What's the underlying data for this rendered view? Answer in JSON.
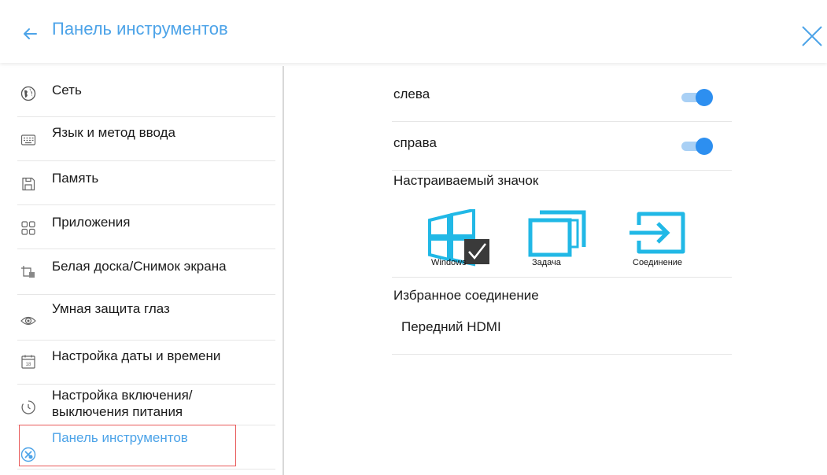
{
  "header": {
    "title": "Панель инструментов"
  },
  "sidebar": {
    "items": [
      {
        "label": "Сеть",
        "icon": "globe-icon"
      },
      {
        "label": "Язык и метод ввода",
        "icon": "keyboard-icon"
      },
      {
        "label": "Память",
        "icon": "storage-icon"
      },
      {
        "label": "Приложения",
        "icon": "apps-grid-icon"
      },
      {
        "label": "Белая доска/Снимок экрана",
        "icon": "whiteboard-icon"
      },
      {
        "label": "Умная защита глаз",
        "icon": "eye-icon"
      },
      {
        "label": "Настройка даты и времени",
        "icon": "calendar-icon",
        "icon_text": "18"
      },
      {
        "label": "Настройка включения/ выключения питания",
        "icon": "timer-icon"
      },
      {
        "label": "Панель инструментов",
        "icon": "toolbar-icon",
        "active": true
      }
    ]
  },
  "content": {
    "left_label": "слева",
    "right_label": "справа",
    "custom_icon_heading": "Настраиваемый значок",
    "shortcuts": [
      {
        "label": "Windows",
        "icon": "windows-icon",
        "checked": true
      },
      {
        "label": "Задача",
        "icon": "task-windows-icon",
        "checked": false
      },
      {
        "label": "Соединение",
        "icon": "input-source-icon",
        "checked": false
      }
    ],
    "favorite_heading": "Избранное соединение",
    "favorite_value": "Передний HDMI"
  },
  "colors": {
    "accent": "#4ca3e8",
    "icon_cyan": "#21b8e6",
    "toggle_on": "#2d8ff0",
    "active_outline": "#e85a5a"
  }
}
